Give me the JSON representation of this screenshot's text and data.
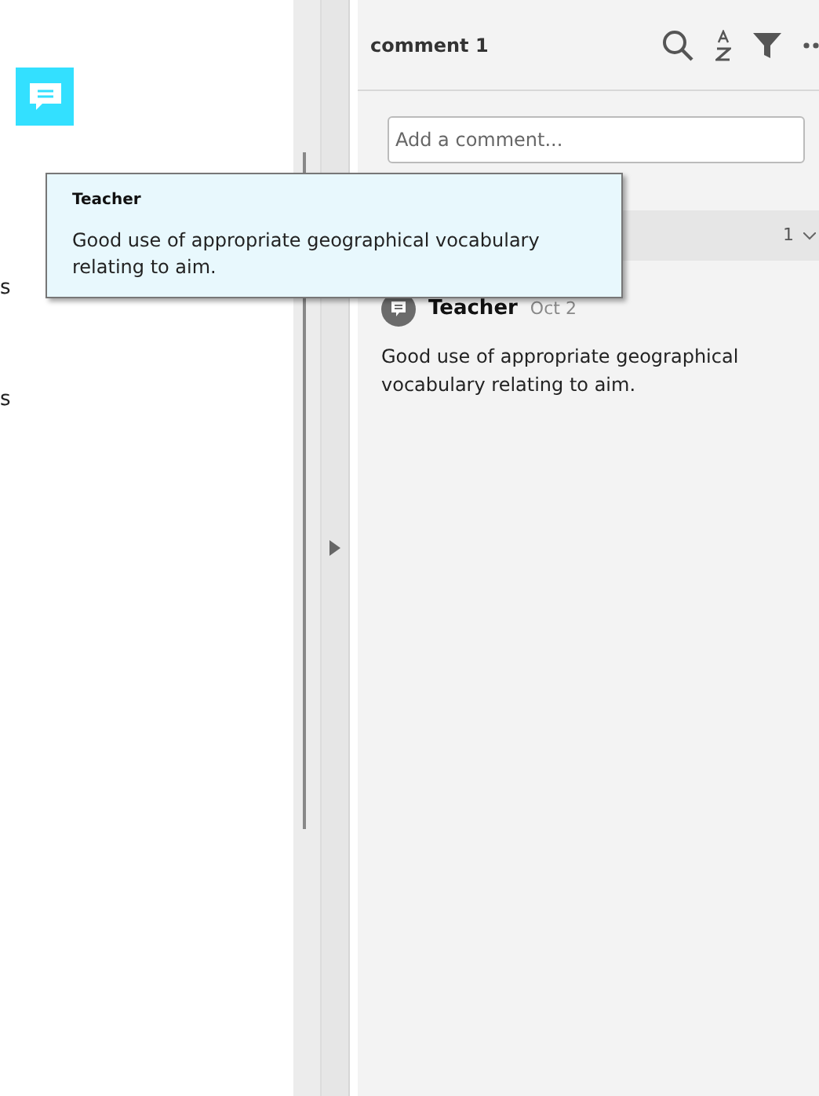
{
  "document": {
    "edge_fragments": [
      "s",
      "s"
    ]
  },
  "comments_panel": {
    "title": "comment 1",
    "comment_field": {
      "placeholder": "Add a comment..."
    },
    "group": {
      "count": "1"
    },
    "comments": [
      {
        "author": "Teacher",
        "date": "Oct 2",
        "text": "Good use of appropriate geographical vocabulary relating to aim."
      }
    ]
  },
  "tooltip": {
    "author": "Teacher",
    "text": "Good use of appropriate geographical vocabulary relating to aim."
  }
}
